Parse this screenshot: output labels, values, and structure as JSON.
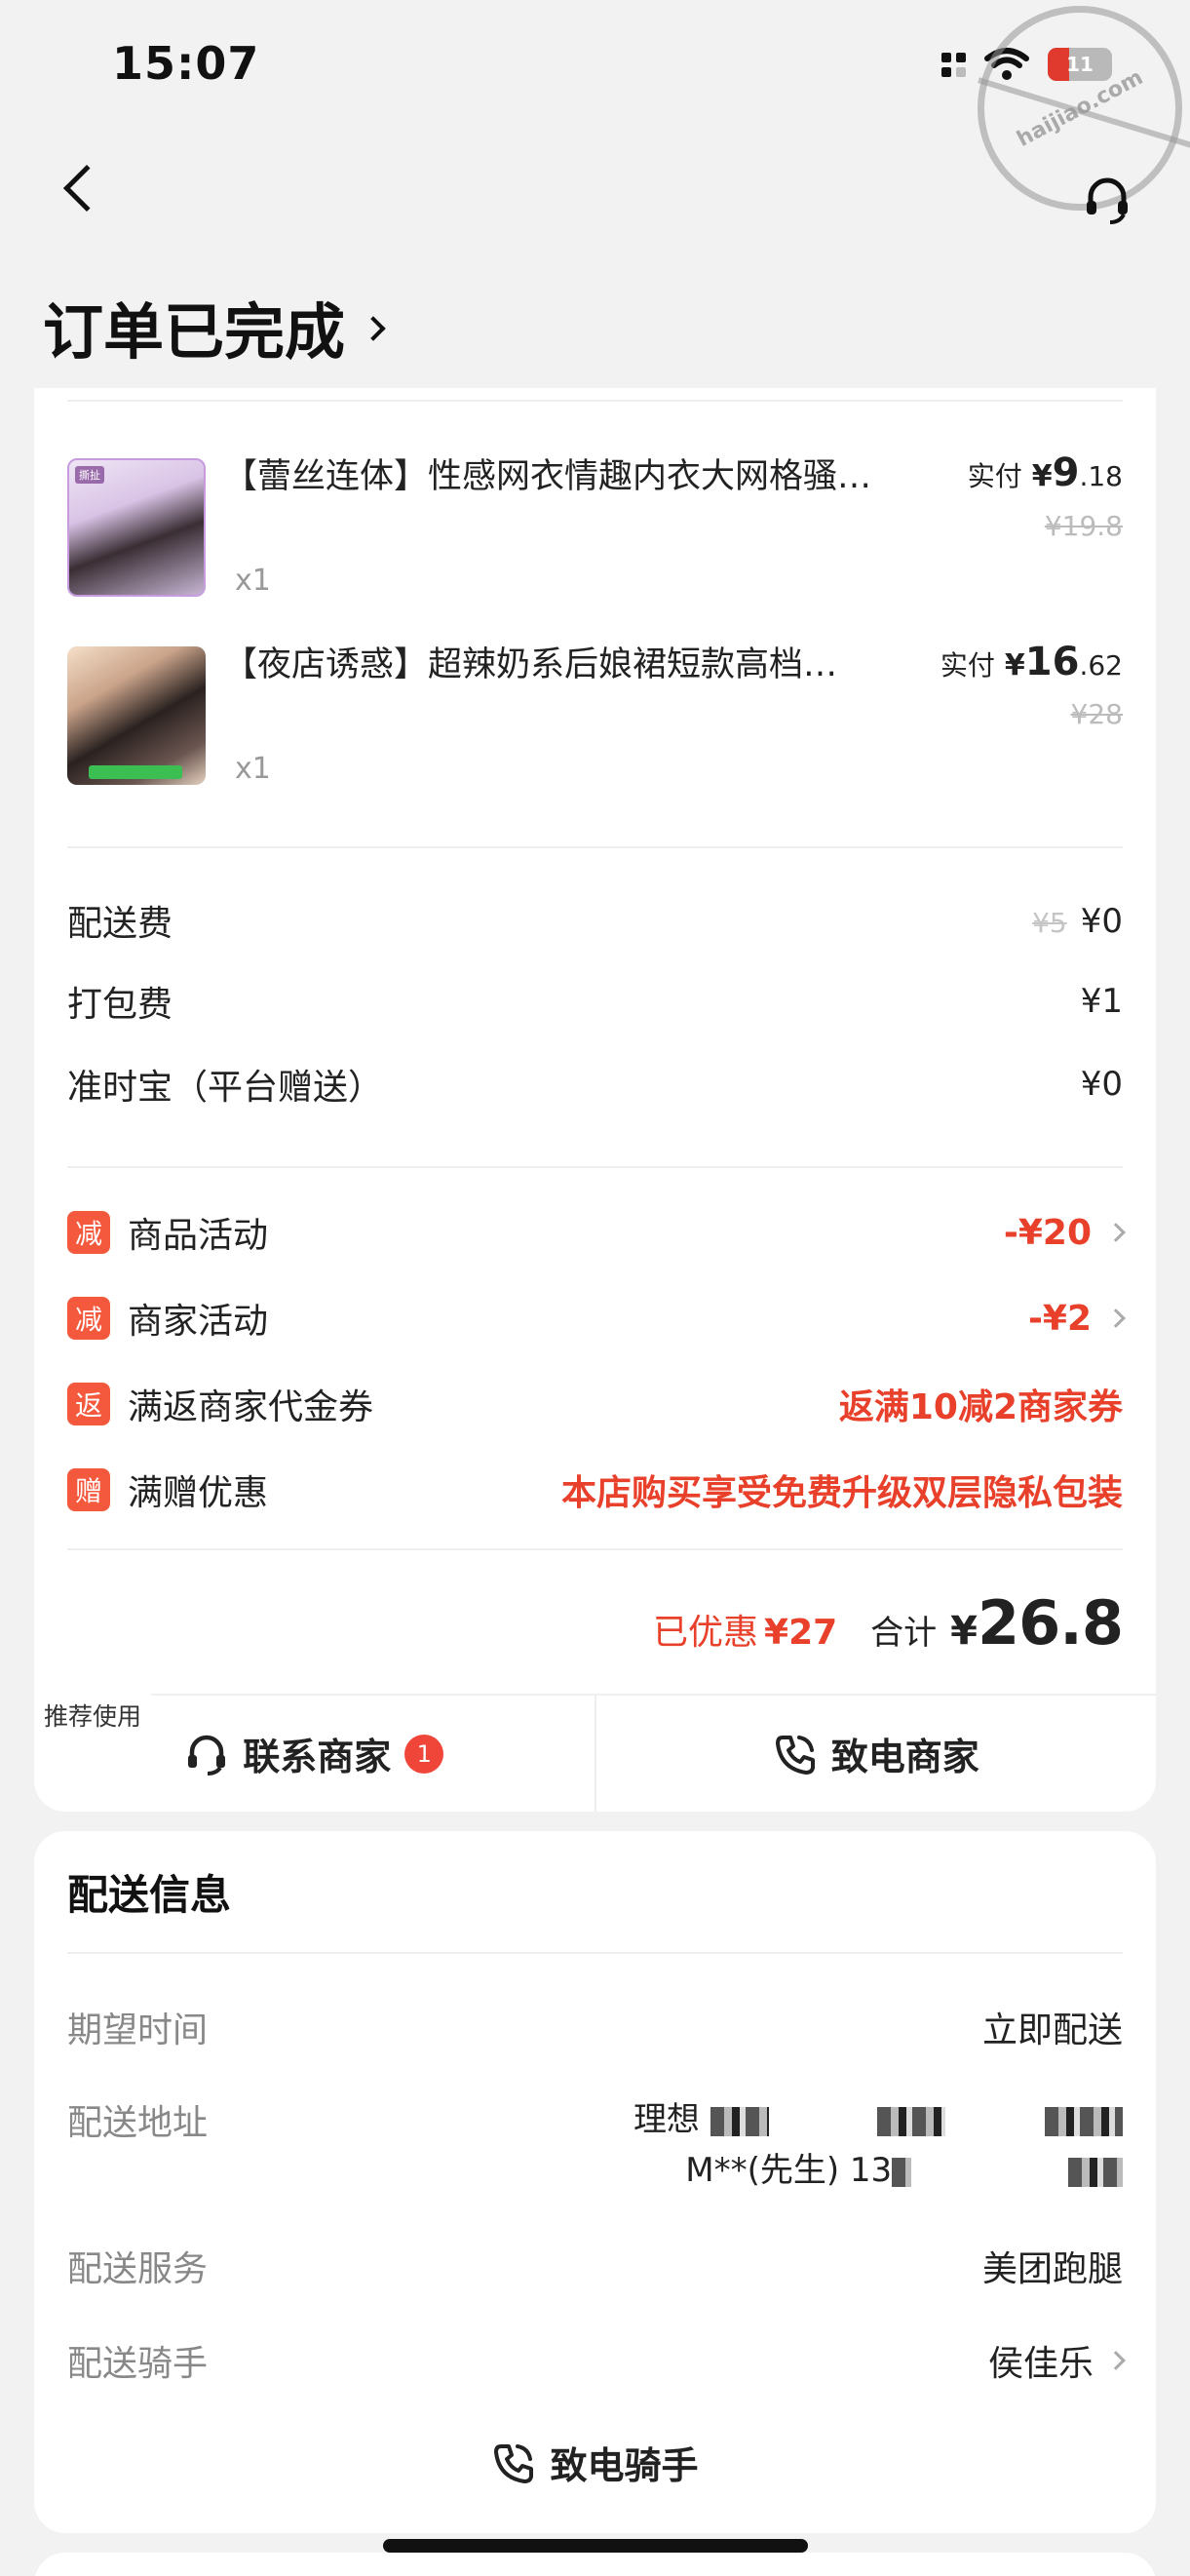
{
  "status_bar": {
    "time": "15:07",
    "battery": "11"
  },
  "watermark": "haijiao.com",
  "header": {
    "title": "订单已完成"
  },
  "products": [
    {
      "name": "【蕾丝连体】性感网衣情趣内衣大网格骚…",
      "qty": "x1",
      "paid_label": "实付",
      "currency": "¥",
      "price_int": "9",
      "price_dec": ".18",
      "original": "¥19.8"
    },
    {
      "name": "【夜店诱惑】超辣奶系后娘裙短款高档…",
      "qty": "x1",
      "paid_label": "实付",
      "currency": "¥",
      "price_int": "16",
      "price_dec": ".62",
      "original": "¥28"
    }
  ],
  "fees": {
    "delivery": {
      "label": "配送费",
      "original": "¥5",
      "value": "¥0"
    },
    "packing": {
      "label": "打包费",
      "value": "¥1"
    },
    "ontime": {
      "label": "准时宝（平台赠送）",
      "value": "¥0"
    }
  },
  "promos": [
    {
      "tag": "减",
      "label": "商品活动",
      "value": "-¥20",
      "has_arrow": true
    },
    {
      "tag": "减",
      "label": "商家活动",
      "value": "-¥2",
      "has_arrow": true
    },
    {
      "tag": "返",
      "label": "满返商家代金券",
      "value": "返满10减2商家券",
      "has_arrow": false
    },
    {
      "tag": "赠",
      "label": "满赠优惠",
      "value": "本店购买享受免费升级双层隐私包装",
      "has_arrow": false
    }
  ],
  "totals": {
    "saved_label": "已优惠",
    "saved_value": "¥27",
    "sum_label": "合计",
    "currency": "¥",
    "sum_value": "26.8"
  },
  "actions": {
    "recommend_tag": "推荐使用",
    "contact_merchant": "联系商家",
    "contact_badge": "1",
    "call_merchant": "致电商家"
  },
  "delivery": {
    "title": "配送信息",
    "expected_time": {
      "label": "期望时间",
      "value": "立即配送"
    },
    "address": {
      "label": "配送地址",
      "line1": "理想",
      "line2": "M**(先生) 13"
    },
    "service": {
      "label": "配送服务",
      "value": "美团跑腿"
    },
    "rider": {
      "label": "配送骑手",
      "value": "侯佳乐"
    },
    "call_rider": "致电骑手"
  },
  "colors": {
    "accent_red": "#e8402a",
    "tag_orange": "#f5593d",
    "badge_red": "#f0463a"
  }
}
